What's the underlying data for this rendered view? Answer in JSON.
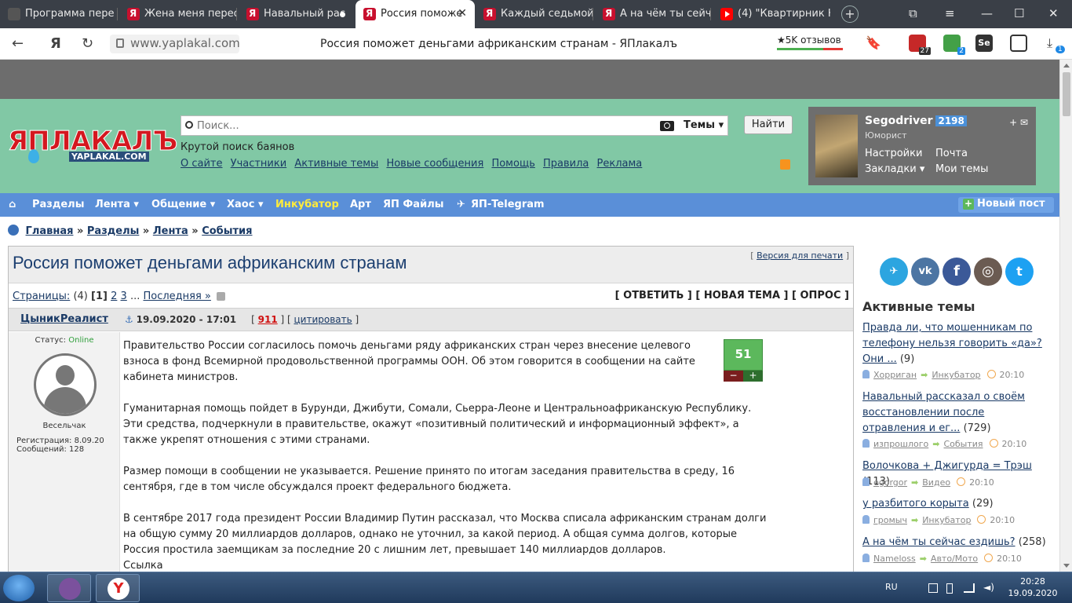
{
  "browser": {
    "tabs": [
      {
        "label": "Программа пере",
        "icon": "program-icon"
      },
      {
        "label": "Жена меня перес",
        "icon": "yaplakal-icon"
      },
      {
        "label": "Навальный рас",
        "icon": "yaplakal-icon"
      },
      {
        "label": "Россия поможе",
        "icon": "yaplakal-icon"
      },
      {
        "label": "Каждый седьмой",
        "icon": "yaplakal-icon"
      },
      {
        "label": "А на чём ты сейча",
        "icon": "yaplakal-icon"
      },
      {
        "label": "(4) \"Квартирник Н",
        "icon": "youtube-icon"
      }
    ],
    "new_tab": "+",
    "url": "www.yaplakal.com",
    "page_title": "Россия поможет деньгами африканским странам - ЯПлакалъ",
    "reviews": "★5K отзывов",
    "ext_badges": {
      "a": "27",
      "b": "2"
    },
    "download_badge": "1"
  },
  "site": {
    "logo_main": "ЯПЛАКАЛЪ",
    "logo_sub": "YAPLAKAL.COM",
    "search_placeholder": "Поиск...",
    "search_scope": "Темы ▾",
    "search_button": "Найти",
    "tagline": "Крутой поиск баянов",
    "links": [
      "О сайте",
      "Участники",
      "Активные темы",
      "Новые сообщения",
      "Помощь",
      "Правила",
      "Реклама"
    ]
  },
  "user": {
    "name": "Segodriver",
    "karma": "2198",
    "rank": "Юморист",
    "settings": "Настройки",
    "mail": "Почта",
    "bookmarks": "Закладки ▾",
    "my_topics": "Мои темы",
    "icons": "+ ✉"
  },
  "nav": {
    "items": [
      "Разделы",
      "Лента ▾",
      "Общение ▾",
      "Хаос ▾",
      "Инкубатор",
      "Арт",
      "ЯП Файлы",
      "ЯП-Telegram"
    ],
    "new_post": "Новый пост"
  },
  "breadcrumb": {
    "items": [
      "Главная",
      "Разделы",
      "Лента",
      "События"
    ],
    "sep": "»"
  },
  "topic": {
    "title": "Россия поможет деньгами африканским странам",
    "print_link": "Версия для печати",
    "pages_label": "Страницы:",
    "pages_count": "(4)",
    "current_page": "[1]",
    "page_2": "2",
    "page_3": "3",
    "ellipsis": "...",
    "last_page": "Последняя »",
    "actions": "[ ОТВЕТИТЬ ] [ НОВАЯ ТЕМА ] [ ОПРОС ]"
  },
  "post": {
    "author": "ЦыникРеалист",
    "anchor": "⚓",
    "date": "19.09.2020 - 17:01",
    "number": "911",
    "quote": "цитировать",
    "status_label": "Статус:",
    "status_value": "Online",
    "rank": "Весельчак",
    "registration": "Регистрация: 8.09.20",
    "messages": "Сообщений: 128",
    "rating": "51",
    "rating_minus": "−",
    "rating_plus": "+",
    "paragraphs": [
      "Правительство России согласилось помочь деньгами ряду африканских стран через внесение целевого взноса в фонд Всемирной продовольственной программы ООН. Об этом говорится в сообщении на сайте кабинета министров.",
      "Гуманитарная помощь пойдет в Бурунди, Джибути, Сомали, Сьерра-Леоне и Центральноафриканскую Республику. Эти средства, подчеркнули в правительстве, окажут «позитивный политический и информационный эффект», а также укрепят отношения с этими странами.",
      "Размер помощи в сообщении не указывается. Решение принято по итогам заседания правительства в среду, 16 сентября, где в том числе обсуждался проект федерального бюджета.",
      "В сентябре 2017 года президент России Владимир Путин рассказал, что Москва списала африканским странам долги на общую сумму 20 миллиардов долларов, однако не уточнил, за какой период. А общая сумма долгов, которые Россия простила заемщикам за последние 20 с лишним лет, превышает 140 миллиардов долларов."
    ],
    "source": "Ссылка"
  },
  "sidebar": {
    "social": [
      {
        "label": "✈",
        "color": "#2ca5e0"
      },
      {
        "label": "vk",
        "color": "#4c75a3"
      },
      {
        "label": "f",
        "color": "#3b5998"
      },
      {
        "label": "◎",
        "color": "#6b5b52"
      },
      {
        "label": "t",
        "color": "#1da1f2"
      }
    ],
    "active_title": "Активные темы",
    "active": [
      {
        "title": "Правда ли, что мошенникам по телефону нельзя говорить «да»? Они ...",
        "count": "(9)",
        "user": "Хорриган",
        "section": "Инкубатор",
        "time": "20:10"
      },
      {
        "title": "Навальный рассказал о своём восстановлении после отравления и ег...",
        "count": "(729)",
        "user": "изпрошлого",
        "section": "События",
        "time": "20:10"
      },
      {
        "title": "Волочкова + Джигурда = Трэш",
        "count": "(113)",
        "user": "egorgor",
        "section": "Видео",
        "time": "20:10"
      },
      {
        "title": "у разбитого корыта",
        "count": "(29)",
        "user": "громыч",
        "section": "Инкубатор",
        "time": "20:10"
      },
      {
        "title": "А на чём ты сейчас ездишь?",
        "count": "(258)",
        "user": "Nameloss",
        "section": "Авто/Мото",
        "time": "20:10"
      }
    ]
  },
  "taskbar": {
    "lang": "RU",
    "time": "20:28",
    "date": "19.09.2020"
  }
}
